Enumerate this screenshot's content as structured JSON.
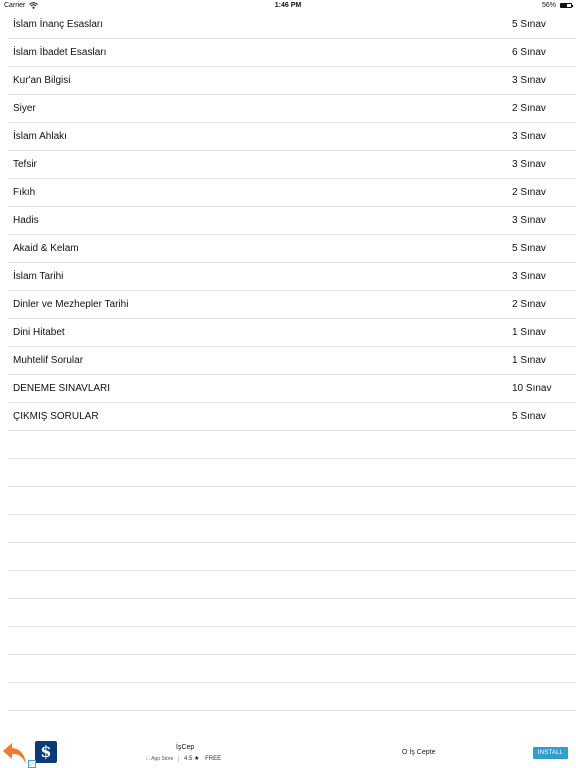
{
  "status_bar": {
    "carrier": "Carrier",
    "time": "1:46 PM",
    "battery_percent": "56%",
    "battery_level": 0.56
  },
  "list": {
    "rows": [
      {
        "title": "İslam İnanç Esasları",
        "count": "5 Sınav"
      },
      {
        "title": "İslam İbadet Esasları",
        "count": "6 Sınav"
      },
      {
        "title": "Kur'an Bilgisi",
        "count": "3 Sınav"
      },
      {
        "title": "Siyer",
        "count": "2 Sınav"
      },
      {
        "title": "İslam Ahlakı",
        "count": "3 Sınav"
      },
      {
        "title": "Tefsir",
        "count": "3 Sınav"
      },
      {
        "title": "Fıkıh",
        "count": "2 Sınav"
      },
      {
        "title": "Hadis",
        "count": "3 Sınav"
      },
      {
        "title": "Akaid & Kelam",
        "count": "5 Sınav"
      },
      {
        "title": "İslam Tarihi",
        "count": "3 Sınav"
      },
      {
        "title": "Dinler ve Mezhepler Tarihi",
        "count": "2 Sınav"
      },
      {
        "title": "Dini Hitabet",
        "count": "1 Sınav"
      },
      {
        "title": "Muhtelif Sorular",
        "count": "1 Sınav"
      },
      {
        "title": "DENEME SINAVLARI",
        "count": "10 Sınav"
      },
      {
        "title": "ÇIKMIŞ SORULAR",
        "count": "5 Sınav"
      }
    ]
  },
  "ad": {
    "app_name": "İşCep",
    "store_label": "App Store",
    "rating": "4.5",
    "price": "FREE",
    "sponsor": "O İş Cepte",
    "install_label": "INSTALL",
    "logo_glyph": "$",
    "ad_choice_glyph": "▷",
    "colors": {
      "install": "#2f9fd1",
      "back_arrow": "#f07a2a",
      "logo_bg": "#0b3a7a"
    }
  }
}
